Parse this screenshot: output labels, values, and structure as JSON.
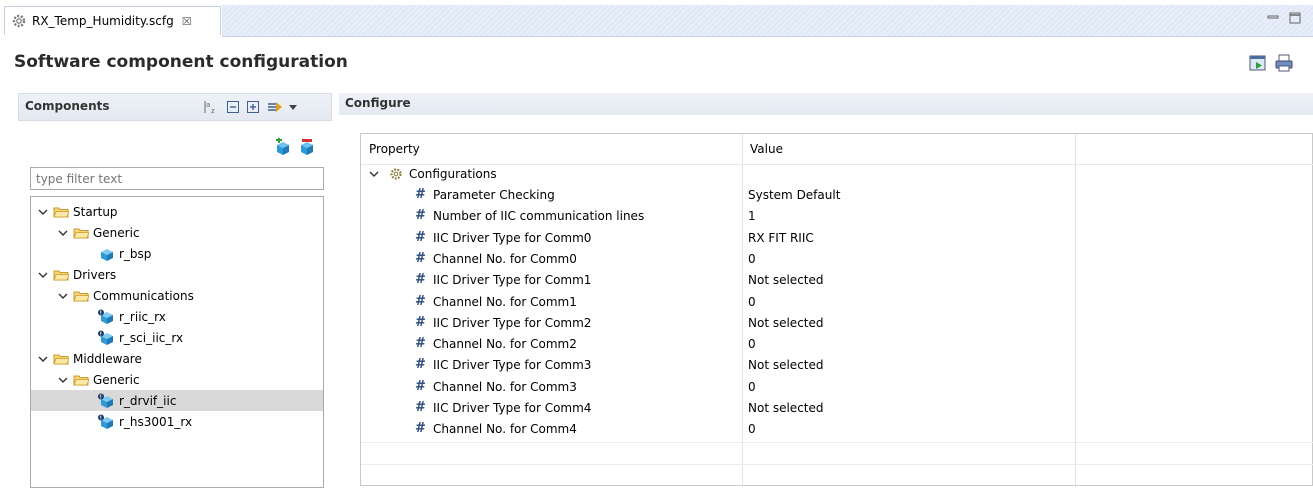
{
  "tab": {
    "title": "RX_Temp_Humidity.scfg",
    "close": "☒"
  },
  "header": {
    "title": "Software component configuration"
  },
  "components": {
    "title": "Components",
    "filter_placeholder": "type filter text",
    "tree": [
      {
        "label": "Startup",
        "level": 0,
        "kind": "folder"
      },
      {
        "label": "Generic",
        "level": 1,
        "kind": "folder"
      },
      {
        "label": "r_bsp",
        "level": 2,
        "kind": "component"
      },
      {
        "label": "Drivers",
        "level": 0,
        "kind": "folder"
      },
      {
        "label": "Communications",
        "level": 1,
        "kind": "folder"
      },
      {
        "label": "r_riic_rx",
        "level": 2,
        "kind": "component"
      },
      {
        "label": "r_sci_iic_rx",
        "level": 2,
        "kind": "component"
      },
      {
        "label": "Middleware",
        "level": 0,
        "kind": "folder"
      },
      {
        "label": "Generic",
        "level": 1,
        "kind": "folder"
      },
      {
        "label": "r_drvif_iic",
        "level": 2,
        "kind": "component",
        "selected": true
      },
      {
        "label": "r_hs3001_rx",
        "level": 2,
        "kind": "component"
      }
    ]
  },
  "configure": {
    "title": "Configure",
    "columns": {
      "property": "Property",
      "value": "Value"
    },
    "group": "Configurations",
    "rows": [
      {
        "property": "Parameter Checking",
        "value": "System Default"
      },
      {
        "property": "Number of IIC communication lines",
        "value": "1"
      },
      {
        "property": "IIC Driver Type for Comm0",
        "value": "RX FIT RIIC"
      },
      {
        "property": "Channel No. for Comm0",
        "value": "0"
      },
      {
        "property": "IIC Driver Type for Comm1",
        "value": "Not selected"
      },
      {
        "property": "Channel No. for Comm1",
        "value": "0"
      },
      {
        "property": "IIC Driver Type for Comm2",
        "value": "Not selected"
      },
      {
        "property": "Channel No. for Comm2",
        "value": "0"
      },
      {
        "property": "IIC Driver Type for Comm3",
        "value": "Not selected"
      },
      {
        "property": "Channel No. for Comm3",
        "value": "0"
      },
      {
        "property": "IIC Driver Type for Comm4",
        "value": "Not selected"
      },
      {
        "property": "Channel No. for Comm4",
        "value": "0"
      }
    ]
  },
  "colors": {
    "accent": "#2a4a7a",
    "folder": "#e8b23a",
    "cube": "#2f9ad6",
    "selection": "#d9d9d9"
  }
}
